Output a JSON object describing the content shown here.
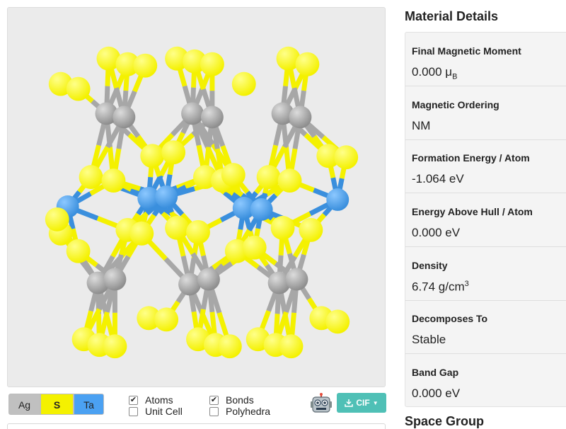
{
  "elements": [
    {
      "symbol": "Ag",
      "color": "#c0c0c0"
    },
    {
      "symbol": "S",
      "color": "#f4f100"
    },
    {
      "symbol": "Ta",
      "color": "#4ba1f2"
    }
  ],
  "display_options": {
    "atoms": {
      "label": "Atoms",
      "checked": true
    },
    "unit_cell": {
      "label": "Unit Cell",
      "checked": false
    },
    "bonds": {
      "label": "Bonds",
      "checked": true
    },
    "polyhedra": {
      "label": "Polyhedra",
      "checked": false
    }
  },
  "toolbar": {
    "robot_icon": "robot-icon",
    "cif_label": "CIF",
    "cif_icon": "download-icon"
  },
  "details": {
    "title": "Material Details",
    "rows": [
      {
        "label": "Final Magnetic Moment",
        "value": "0.000 μ",
        "sub": "B"
      },
      {
        "label": "Magnetic Ordering",
        "value": "NM"
      },
      {
        "label": "Formation Energy / Atom",
        "value": "-1.064 eV"
      },
      {
        "label": "Energy Above Hull / Atom",
        "value": "0.000 eV"
      },
      {
        "label": "Density",
        "value": "6.74 g/cm",
        "sup": "3"
      },
      {
        "label": "Decomposes To",
        "value": "Stable"
      },
      {
        "label": "Band Gap",
        "value": "0.000 eV"
      }
    ]
  },
  "space_group_title": "Space Group",
  "colors": {
    "silver": "#a9a9a9",
    "sulfur": "#f4f100",
    "tantalum": "#3a8fdd",
    "accent": "#4fc0b6"
  }
}
